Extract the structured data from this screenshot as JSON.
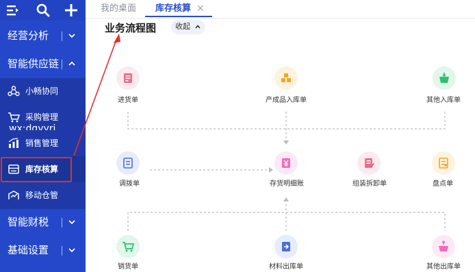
{
  "sidebar": {
    "sections": [
      {
        "label": "经营分析"
      },
      {
        "label": "智能供应链"
      },
      {
        "label": "智能财税"
      },
      {
        "label": "基础设置"
      }
    ],
    "items": [
      {
        "label": "小畅协同",
        "icon": "collaboration-icon"
      },
      {
        "label": "采购管理",
        "icon": "purchase-cart-icon"
      },
      {
        "label": "销售管理",
        "icon": "sales-chart-icon"
      },
      {
        "label": "库存核算",
        "icon": "inventory-icon"
      },
      {
        "label": "移动仓管",
        "icon": "mobile-warehouse-icon"
      }
    ],
    "watermark": "wx:dgyyrj"
  },
  "tabs": [
    {
      "label": "我的桌面"
    },
    {
      "label": "库存核算"
    }
  ],
  "page": {
    "title": "业务流程图",
    "collapse_label": "收起"
  },
  "flow": {
    "nodes": [
      {
        "label": "进货单",
        "icon": "purchase-receipt-icon",
        "color": "#f06b8a"
      },
      {
        "label": "产成品入库单",
        "icon": "product-boxes-icon",
        "color": "#f5a623"
      },
      {
        "label": "其他入库单",
        "icon": "basket-in-icon",
        "color": "#2fbf71"
      },
      {
        "label": "调拨单",
        "icon": "transfer-doc-icon",
        "color": "#4a6fd6"
      },
      {
        "label": "存货明细账",
        "icon": "ledger-yen-icon",
        "color": "#f06bbf"
      },
      {
        "label": "组装拆卸单",
        "icon": "assembly-doc-icon",
        "color": "#f06b8a"
      },
      {
        "label": "盘点单",
        "icon": "stocktake-icon",
        "color": "#f5a623"
      },
      {
        "label": "销货单",
        "icon": "sales-cart-icon",
        "color": "#2fbf71"
      },
      {
        "label": "材料出库单",
        "icon": "material-out-icon",
        "color": "#4a6fd6"
      },
      {
        "label": "其他出库单",
        "icon": "basket-out-icon",
        "color": "#f06bbf"
      }
    ]
  },
  "colors": {
    "sidebar": "#2448c9",
    "accent": "#2a4ec9",
    "highlight": "#e0302f"
  }
}
